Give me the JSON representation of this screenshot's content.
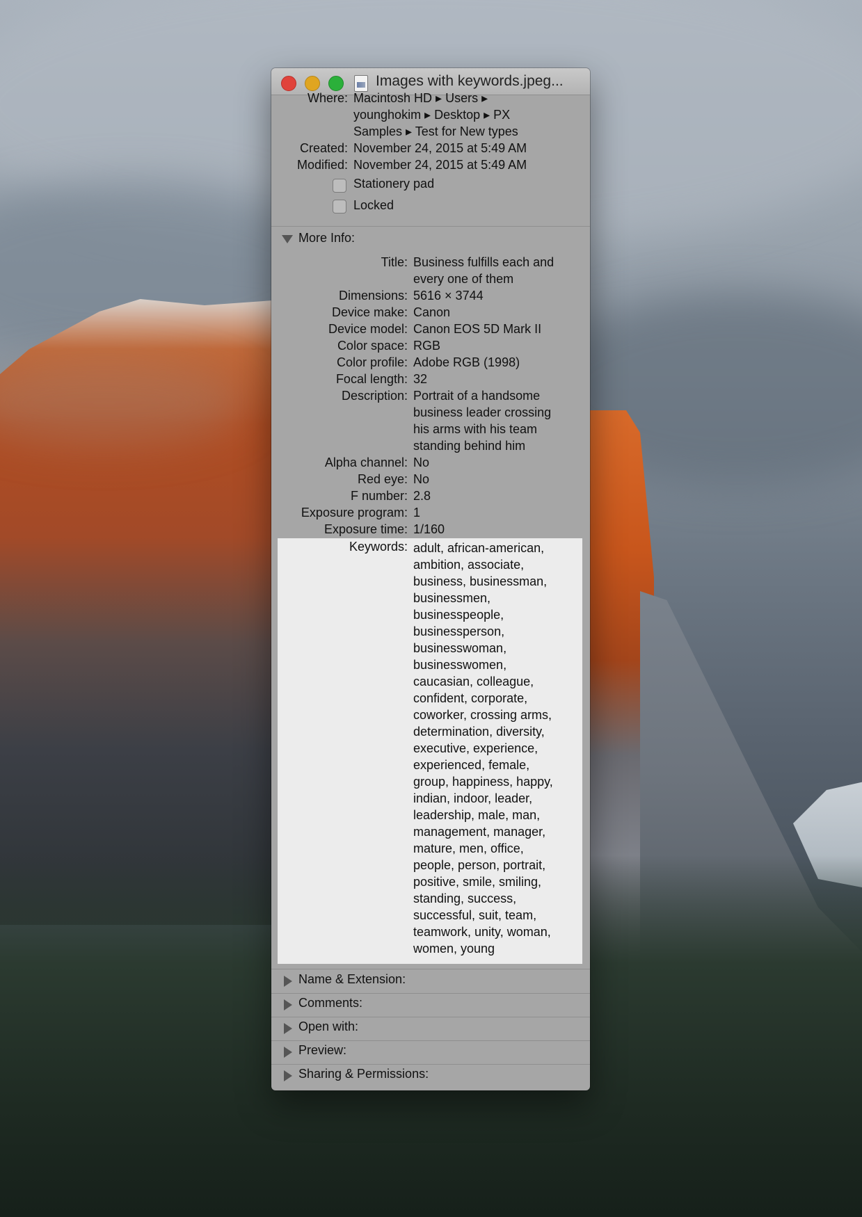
{
  "window": {
    "title": "Images with keywords.jpeg..."
  },
  "general": {
    "where_label": "Where:",
    "where_lines": [
      "Macintosh HD ▸ Users ▸",
      "younghokim ▸ Desktop ▸ PX",
      "Samples ▸ Test for New types"
    ],
    "created_label": "Created:",
    "created_value": "November 24, 2015 at 5:49 AM",
    "modified_label": "Modified:",
    "modified_value": "November 24, 2015 at 5:49 AM",
    "stationery_label": "Stationery pad",
    "stationery_checked": false,
    "locked_label": "Locked",
    "locked_checked": false
  },
  "more_info": {
    "header": "More Info:",
    "fields": [
      {
        "label": "Title:",
        "lines": [
          "Business fulfills each and",
          "every one of them"
        ]
      },
      {
        "label": "Dimensions:",
        "lines": [
          "5616 × 3744"
        ]
      },
      {
        "label": "Device make:",
        "lines": [
          "Canon"
        ]
      },
      {
        "label": "Device model:",
        "lines": [
          "Canon EOS 5D Mark II"
        ]
      },
      {
        "label": "Color space:",
        "lines": [
          "RGB"
        ]
      },
      {
        "label": "Color profile:",
        "lines": [
          "Adobe RGB (1998)"
        ]
      },
      {
        "label": "Focal length:",
        "lines": [
          "32"
        ]
      },
      {
        "label": "Description:",
        "lines": [
          "Portrait of a handsome",
          "business leader crossing",
          "his arms with his team",
          "standing behind him"
        ]
      },
      {
        "label": "Alpha channel:",
        "lines": [
          "No"
        ]
      },
      {
        "label": "Red eye:",
        "lines": [
          "No"
        ]
      },
      {
        "label": "F number:",
        "lines": [
          "2.8"
        ]
      },
      {
        "label": "Exposure program:",
        "lines": [
          "1"
        ]
      },
      {
        "label": "Exposure time:",
        "lines": [
          "1/160"
        ]
      }
    ],
    "keywords_label": "Keywords:",
    "keywords_lines": [
      "adult, african-american,",
      "ambition, associate,",
      "business, businessman,",
      "businessmen,",
      "businesspeople,",
      "businessperson,",
      "businesswoman,",
      "businesswomen,",
      "caucasian, colleague,",
      "confident, corporate,",
      "coworker, crossing arms,",
      "determination, diversity,",
      "executive, experience,",
      "experienced, female,",
      "group, happiness, happy,",
      "indian, indoor, leader,",
      "leadership, male, man,",
      "management, manager,",
      "mature, men, office,",
      "people, person, portrait,",
      "positive, smile, smiling,",
      "standing, success,",
      "successful, suit, team,",
      "teamwork, unity, woman,",
      "women, young"
    ]
  },
  "sections": {
    "name_extension": "Name & Extension:",
    "comments": "Comments:",
    "open_with": "Open with:",
    "preview": "Preview:",
    "sharing": "Sharing & Permissions:"
  },
  "colors": {
    "window_bg": "#a6a6a6",
    "keywords_highlight": "#ececec",
    "close_button": "#e0433b",
    "minimize_button": "#e0a520",
    "zoom_button": "#2bb03a"
  },
  "icons": [
    "close-button",
    "minimize-button",
    "zoom-button",
    "jpeg-document-icon",
    "disclosure-triangle-icon",
    "checkbox"
  ]
}
